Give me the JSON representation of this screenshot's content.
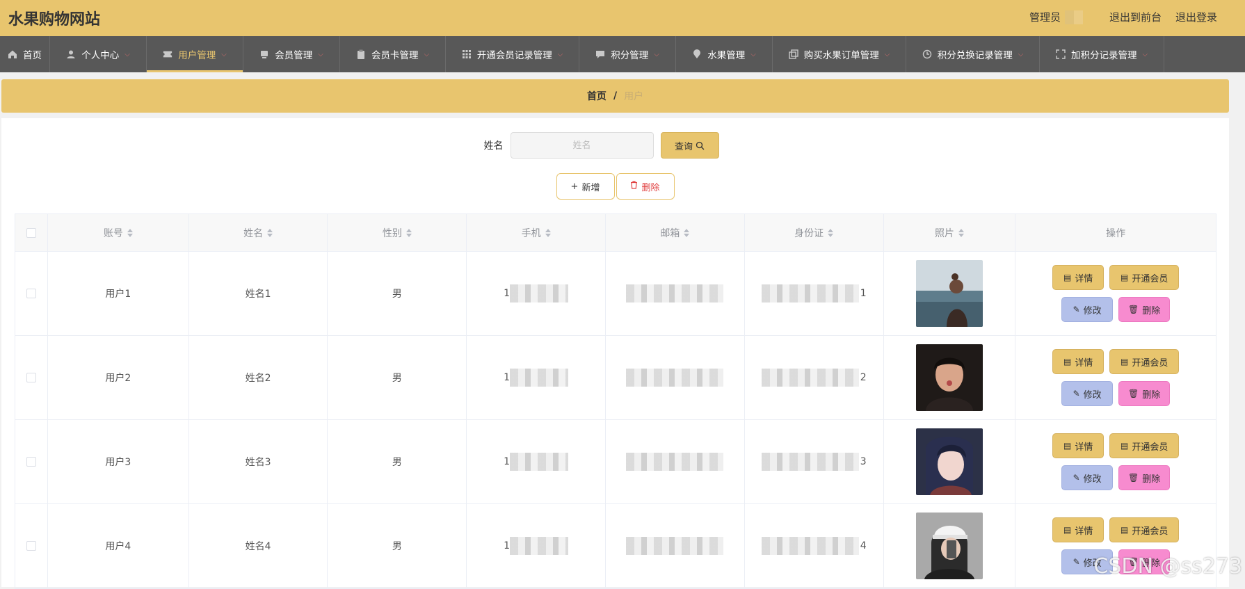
{
  "header": {
    "site_title": "水果购物网站",
    "admin_label": "管理员",
    "to_front_label": "退出到前台",
    "logout_label": "退出登录"
  },
  "nav": [
    {
      "label": "首页",
      "icon": "home-icon"
    },
    {
      "label": "个人中心",
      "icon": "user-icon"
    },
    {
      "label": "用户管理",
      "icon": "ticket-icon",
      "active": true
    },
    {
      "label": "会员管理",
      "icon": "card-icon"
    },
    {
      "label": "会员卡管理",
      "icon": "clipboard-icon"
    },
    {
      "label": "开通会员记录管理",
      "icon": "grid-icon"
    },
    {
      "label": "积分管理",
      "icon": "chat-icon"
    },
    {
      "label": "水果管理",
      "icon": "location-icon"
    },
    {
      "label": "购买水果订单管理",
      "icon": "copy-icon"
    },
    {
      "label": "积分兑换记录管理",
      "icon": "clock-icon"
    },
    {
      "label": "加积分记录管理",
      "icon": "fullscreen-icon"
    }
  ],
  "breadcrumb": {
    "home": "首页",
    "separator": "/",
    "current": "用户"
  },
  "search": {
    "label": "姓名",
    "placeholder": "姓名",
    "button": "查询"
  },
  "actions": {
    "add": "新增",
    "delete": "删除"
  },
  "table": {
    "columns": [
      "账号",
      "姓名",
      "性别",
      "手机",
      "邮箱",
      "身份证",
      "照片",
      "操作"
    ],
    "rows": [
      {
        "account": "用户1",
        "name": "姓名1",
        "gender": "男",
        "phone_head": "1",
        "id_tail": "1"
      },
      {
        "account": "用户2",
        "name": "姓名2",
        "gender": "男",
        "phone_head": "1",
        "id_tail": "2"
      },
      {
        "account": "用户3",
        "name": "姓名3",
        "gender": "男",
        "phone_head": "1",
        "id_tail": "3"
      },
      {
        "account": "用户4",
        "name": "姓名4",
        "gender": "男",
        "phone_head": "1",
        "id_tail": "4"
      }
    ],
    "row_actions": {
      "detail": "详情",
      "member": "开通会员",
      "edit": "修改",
      "delete": "删除"
    }
  },
  "watermark": "CSDN @ss273",
  "colors": {
    "accent": "#e8c56e",
    "nav_bg": "#585858",
    "edit": "#b3c0ea",
    "delete": "#f78bcf"
  }
}
